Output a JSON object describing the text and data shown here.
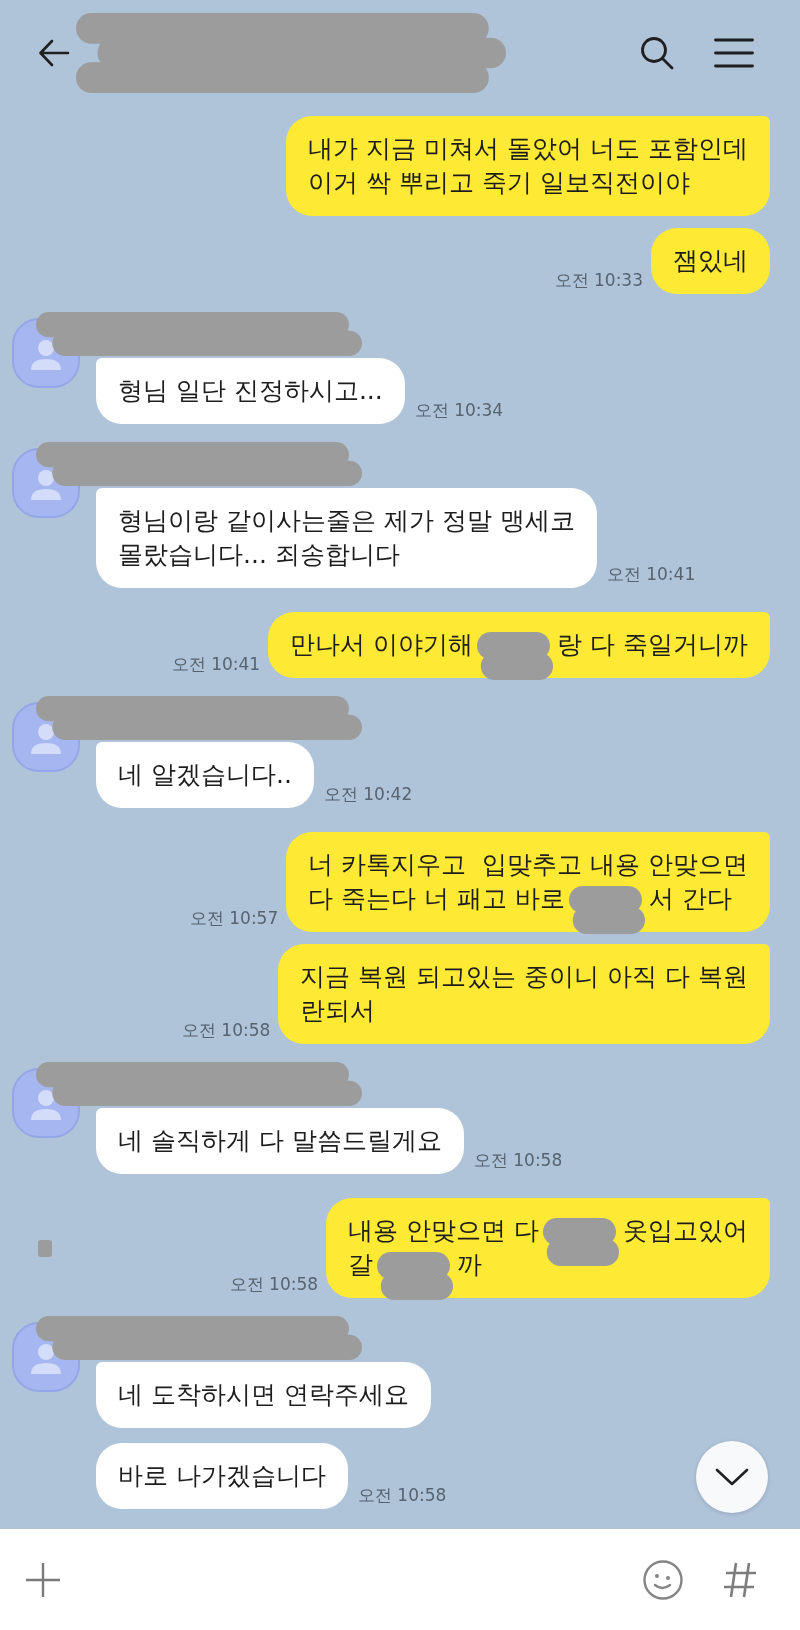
{
  "messages": [
    {
      "kind": "sent",
      "side_redaction": false,
      "time": "오전 10:33",
      "bubbles": [
        {
          "lines": [
            [
              {
                "kind": "text",
                "text": "내가 지금 미쳐서 돌았어 너도 포함인데"
              }
            ],
            [
              {
                "kind": "text",
                "text": "이거 싹 뿌리고 죽기 일보직전이야"
              }
            ]
          ]
        },
        {
          "lines": [
            [
              {
                "kind": "text",
                "text": "잼있네"
              }
            ]
          ]
        }
      ]
    },
    {
      "kind": "received",
      "side_redaction": false,
      "time": "오전 10:34",
      "bubbles": [
        {
          "lines": [
            [
              {
                "kind": "text",
                "text": "형님 일단 진정하시고..."
              }
            ]
          ]
        }
      ]
    },
    {
      "kind": "received",
      "side_redaction": false,
      "time": "오전 10:41",
      "bubbles": [
        {
          "lines": [
            [
              {
                "kind": "text",
                "text": "형님이랑 같이사는줄은 제가 정말 맹세코"
              }
            ],
            [
              {
                "kind": "text",
                "text": "몰랐습니다... 죄송합니다"
              }
            ]
          ]
        }
      ]
    },
    {
      "kind": "sent",
      "side_redaction": false,
      "time": "오전 10:41",
      "bubbles": [
        {
          "lines": [
            [
              {
                "kind": "text",
                "text": "만나서 이야기해"
              },
              {
                "kind": "redaction"
              },
              {
                "kind": "text",
                "text": "랑 다 죽일거니까"
              }
            ]
          ]
        }
      ]
    },
    {
      "kind": "received",
      "side_redaction": false,
      "time": "오전 10:42",
      "bubbles": [
        {
          "lines": [
            [
              {
                "kind": "text",
                "text": "네 알겠습니다.."
              }
            ]
          ]
        }
      ]
    },
    {
      "kind": "sent",
      "side_redaction": false,
      "time": "오전 10:57",
      "bubbles": [
        {
          "lines": [
            [
              {
                "kind": "text",
                "text": "너 카톡지우고  입맞추고 내용 안맞으면"
              }
            ],
            [
              {
                "kind": "text",
                "text": "다 죽는다 너 패고 바로"
              },
              {
                "kind": "redaction"
              },
              {
                "kind": "text",
                "text": "서 간다"
              }
            ]
          ]
        }
      ]
    },
    {
      "kind": "sent",
      "side_redaction": false,
      "time": "오전 10:58",
      "bubbles": [
        {
          "lines": [
            [
              {
                "kind": "text",
                "text": "지금 복원 되고있는 중이니 아직 다 복원"
              }
            ],
            [
              {
                "kind": "text",
                "text": "란되서"
              }
            ]
          ]
        }
      ]
    },
    {
      "kind": "received",
      "side_redaction": false,
      "time": "오전 10:58",
      "bubbles": [
        {
          "lines": [
            [
              {
                "kind": "text",
                "text": "네 솔직하게 다 말씀드릴게요"
              }
            ]
          ]
        }
      ]
    },
    {
      "kind": "sent",
      "side_redaction": true,
      "time": "오전 10:58",
      "bubbles": [
        {
          "lines": [
            [
              {
                "kind": "text",
                "text": "내용 안맞으면 다"
              },
              {
                "kind": "redaction"
              },
              {
                "kind": "text",
                "text": "옷입고있어"
              }
            ],
            [
              {
                "kind": "text",
                "text": "갈"
              },
              {
                "kind": "redaction"
              },
              {
                "kind": "text",
                "text": "까"
              }
            ]
          ]
        }
      ]
    },
    {
      "kind": "received",
      "side_redaction": false,
      "time": "오전 10:58",
      "bubbles": [
        {
          "lines": [
            [
              {
                "kind": "text",
                "text": "네 도착하시면 연락주세요"
              }
            ]
          ]
        },
        {
          "lines": [
            [
              {
                "kind": "text",
                "text": "바로 나가겠습니다"
              }
            ]
          ]
        }
      ]
    }
  ]
}
